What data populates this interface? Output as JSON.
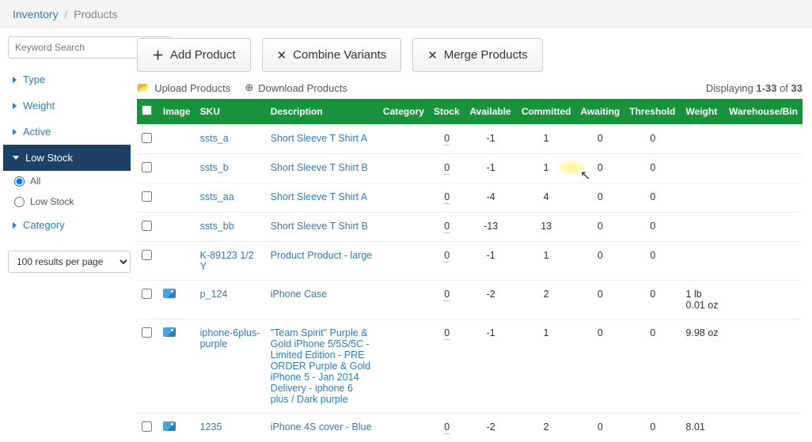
{
  "breadcrumb": {
    "main": "Inventory",
    "sub": "Products"
  },
  "sidebar": {
    "search_placeholder": "Keyword Search",
    "filters": {
      "type": "Type",
      "weight": "Weight",
      "active": "Active",
      "low_stock": "Low Stock",
      "category": "Category"
    },
    "radio": {
      "all": "All",
      "low_stock": "Low Stock"
    },
    "results_per_page": "100 results per page"
  },
  "toolbar": {
    "add_product": "Add Product",
    "combine_variants": "Combine Variants",
    "merge_products": "Merge Products",
    "upload": "Upload Products",
    "download": "Download Products"
  },
  "displaying": {
    "prefix": "Displaying ",
    "range": "1-33",
    "mid": " of ",
    "total": "33"
  },
  "columns": {
    "image": "Image",
    "sku": "SKU",
    "description": "Description",
    "category": "Category",
    "stock": "Stock",
    "available": "Available",
    "committed": "Committed",
    "awaiting": "Awaiting",
    "threshold": "Threshold",
    "weight": "Weight",
    "warehouse": "Warehouse/Bin"
  },
  "rows": [
    {
      "has_image": false,
      "sku": "ssts_a",
      "desc": "Short Sleeve T Shirt A",
      "stock": "0",
      "available": "-1",
      "committed": "1",
      "awaiting": "0",
      "threshold": "0",
      "weight": ""
    },
    {
      "has_image": false,
      "sku": "ssts_b",
      "desc": "Short Sleeve T Shirt B",
      "stock": "0",
      "available": "-1",
      "committed": "1",
      "awaiting": "0",
      "threshold": "0",
      "weight": ""
    },
    {
      "has_image": false,
      "sku": "ssts_aa",
      "desc": "Short Sleeve T Shirt A",
      "stock": "0",
      "available": "-4",
      "committed": "4",
      "awaiting": "0",
      "threshold": "0",
      "weight": ""
    },
    {
      "has_image": false,
      "sku": "ssts_bb",
      "desc": "Short Sleeve T Shirt B",
      "stock": "0",
      "available": "-13",
      "committed": "13",
      "awaiting": "0",
      "threshold": "0",
      "weight": ""
    },
    {
      "has_image": false,
      "sku": "K-89123 1/2 Y",
      "desc": "Product Product - large",
      "stock": "0",
      "available": "-1",
      "committed": "1",
      "awaiting": "0",
      "threshold": "0",
      "weight": ""
    },
    {
      "has_image": true,
      "sku": "p_124",
      "desc": "iPhone Case",
      "stock": "0",
      "available": "-2",
      "committed": "2",
      "awaiting": "0",
      "threshold": "0",
      "weight": "1 lb 0.01 oz"
    },
    {
      "has_image": true,
      "sku": "iphone-6plus-purple",
      "desc": "\"Team Spirit\" Purple & Gold iPhone 5/5S/5C - Limited Edition - PRE ORDER Purple & Gold iPhone 5 - Jan 2014 Delivery - iphone 6 plus / Dark purple",
      "stock": "0",
      "available": "-1",
      "committed": "1",
      "awaiting": "0",
      "threshold": "0",
      "weight": "9.98 oz"
    },
    {
      "has_image": true,
      "sku": "1235",
      "desc": "iPhone 4S cover - Blue",
      "stock": "0",
      "available": "-2",
      "committed": "2",
      "awaiting": "0",
      "threshold": "0",
      "weight": "8.01"
    }
  ]
}
